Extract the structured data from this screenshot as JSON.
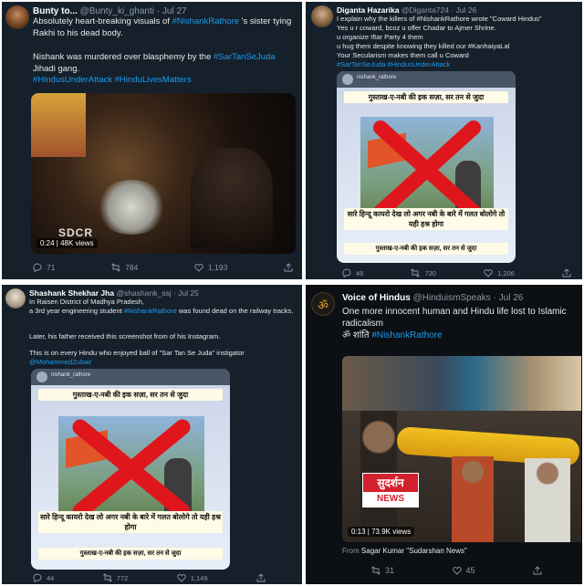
{
  "tweets": [
    {
      "name": "Bunty to...",
      "handle": "@Bunty_ki_ghanti",
      "date": "Jul 27",
      "text_pre": "Absolutely heart-breaking visuals of ",
      "mention": "#NishankRathore",
      "text_post": " 's sister tying Rakhi to his dead body.",
      "line2_pre": "Nishank was murdered over blasphemy by the ",
      "line2_tag": "#SarTanSeJuda",
      "line2_post": " Jihadi gang.",
      "tags": "#HindusUnderAttack #HinduLivesMatters",
      "video_time": "0:24",
      "video_views": "48K views",
      "video_watermark": "SDCR",
      "replies": "71",
      "retweets": "784",
      "likes": "1,193"
    },
    {
      "name": "Diganta Hazarika",
      "handle": "@Diganta724",
      "date": "Jul 26",
      "lines": [
        "I explain why the killers of #NishankRathore wrote \"Coward Hindus\"",
        "Yes u r coward, bcoz u offer Chadar to Ajmer Shrine.",
        "u organize Iftar Party 4 them",
        "u hug them despite knowing they killed our #KanhaiyaLal",
        "Your Secularism makes them call u Coward",
        "#SarTanSeJuda #HindusUnderAttack"
      ],
      "insta_user": "nishank_rathore",
      "hindi_top": "गुस्ताख-ए-नबी की इक सज़ा, सर तन से जुदा",
      "hindi_mid": "सारे हिन्दू कायरो देख लो अगर नबी के बारे में गलत बोलोगे तो यही हश्र होगा",
      "hindi_bottom": "गुस्ताख-ए-नबी की इक सज़ा, सर तन से जुदा",
      "replies": "48",
      "retweets": "730",
      "likes": "1,206"
    },
    {
      "name": "Shashank Shekhar Jha",
      "handle": "@shashank_ssj",
      "date": "Jul 25",
      "lines": [
        "In Raisen District of Madhya Pradesh,",
        "a 3rd year engineering student #NishankRathore was found dead on the railway tracks.",
        "",
        "Later, his father received this screenshot from of his Instagram.",
        "",
        "This is on every Hindu who enjoyed ball of \"Sar Tan Se Juda\" instigator",
        "@MohammedZubair"
      ],
      "insta_user": "nishank_rathore",
      "hindi_top": "गुस्ताख-ए-नबी की इक सज़ा, सर तन से जुदा",
      "hindi_mid": "सारे हिन्दू कायरो देख लो अगर नबी के बारे में गलत बोलोगे तो यही हश्र होगा",
      "hindi_bottom": "गुस्ताख-ए-नबी की इक सज़ा, सर तन से जुदा",
      "replies": "44",
      "retweets": "772",
      "likes": "1,149"
    },
    {
      "name": "Voice of Hindus",
      "handle": "@HinduismSpeaks",
      "date": "Jul 26",
      "text": "One more innocent human and Hindu life lost to Islamic radicalism",
      "line2_prefix": "ॐ शांति",
      "line2_tag": "#NishankRathore",
      "brand_top": "सुदर्शन",
      "brand_bottom": "NEWS",
      "video_time": "0:13",
      "video_views": "73.9K views",
      "from_label": "From",
      "from_source": "Sagar Kumar \"Sudarshan News\"",
      "retweets": "31",
      "likes": "45"
    }
  ],
  "colors": {
    "background": "#15202b",
    "link": "#1d9bf0",
    "muted": "#8b98a5"
  }
}
